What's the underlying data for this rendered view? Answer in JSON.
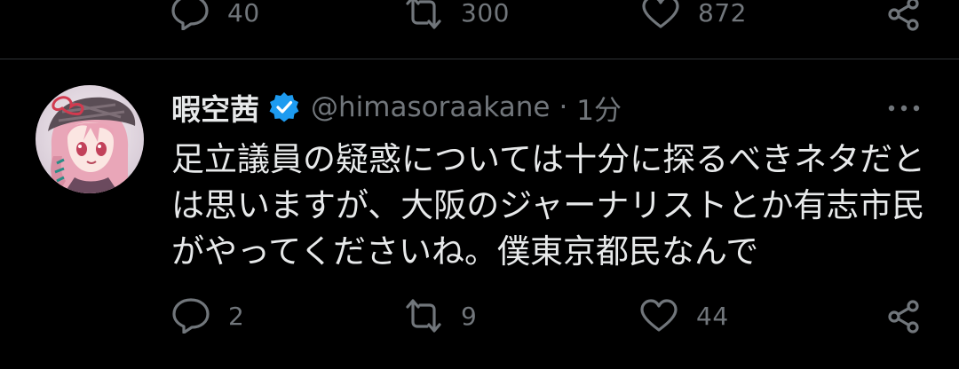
{
  "previous_tweet": {
    "actions": {
      "reply_count": "40",
      "retweet_count": "300",
      "like_count": "872"
    }
  },
  "tweet": {
    "display_name": "暇空茜",
    "verified": true,
    "handle": "@himasoraakane",
    "separator": "·",
    "time": "1分",
    "text_lines": [
      "足立議員の疑惑については十分に探るべきネタだと",
      "は思いますが、大阪のジャーナリストとか有志市民",
      "がやってくださいね。僕東京都民なんで"
    ],
    "actions": {
      "reply_count": "2",
      "retweet_count": "9",
      "like_count": "44"
    }
  },
  "icons": {
    "reply": "speech-bubble-icon",
    "retweet": "retweet-arrows-icon",
    "like": "heart-outline-icon",
    "share": "share-nodes-icon",
    "more": "more-dots-icon",
    "verified": "verified-badge-icon"
  },
  "colors": {
    "background": "#000000",
    "text_primary": "#e7e9ea",
    "text_secondary": "#71767b",
    "divider": "#2f3336",
    "verified_blue": "#1d9bf0"
  }
}
